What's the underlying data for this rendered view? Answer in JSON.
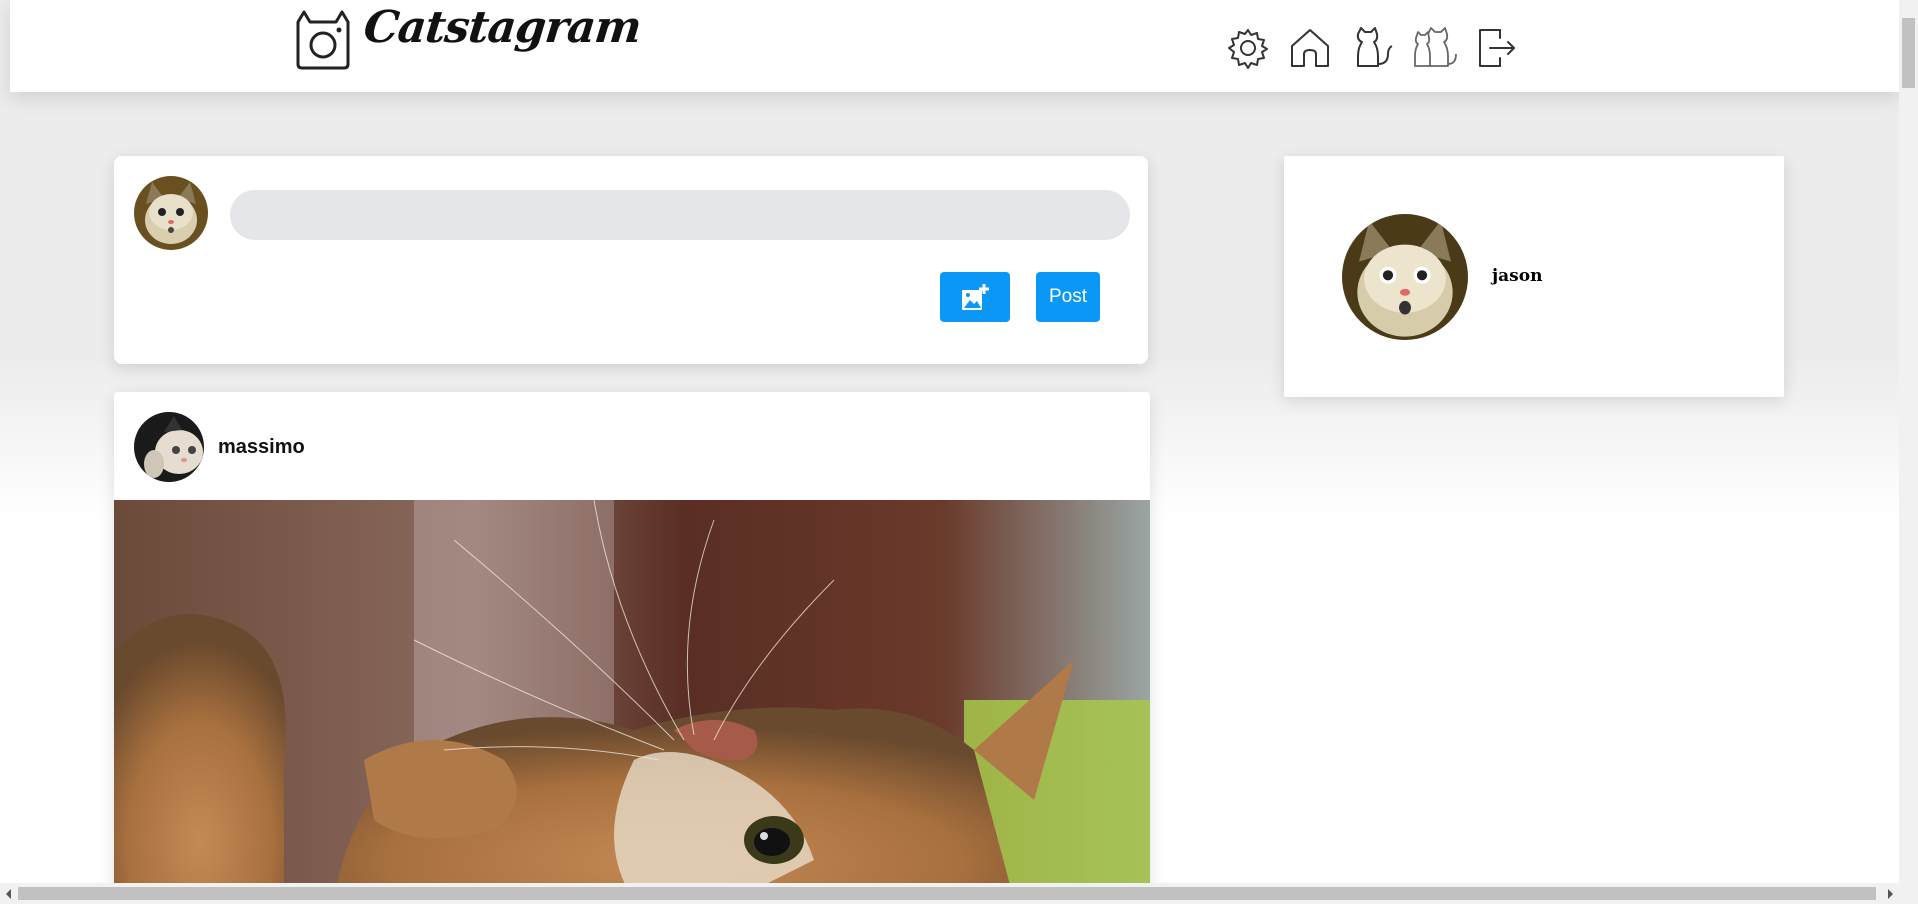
{
  "app": {
    "name": "Catstagram"
  },
  "header": {
    "logo_text": "Catstagram",
    "nav": [
      {
        "name": "settings-icon"
      },
      {
        "name": "home-icon"
      },
      {
        "name": "cat-icon"
      },
      {
        "name": "cats-icon"
      },
      {
        "name": "logout-icon"
      }
    ]
  },
  "composer": {
    "placeholder": "",
    "add_image_icon": "add-photo-icon",
    "post_label": "Post"
  },
  "profile": {
    "username": "jason"
  },
  "post": {
    "author": "massimo"
  },
  "colors": {
    "accent": "#0a97f5",
    "input_bg": "#e4e6ea",
    "page_bg": "#ececec"
  }
}
